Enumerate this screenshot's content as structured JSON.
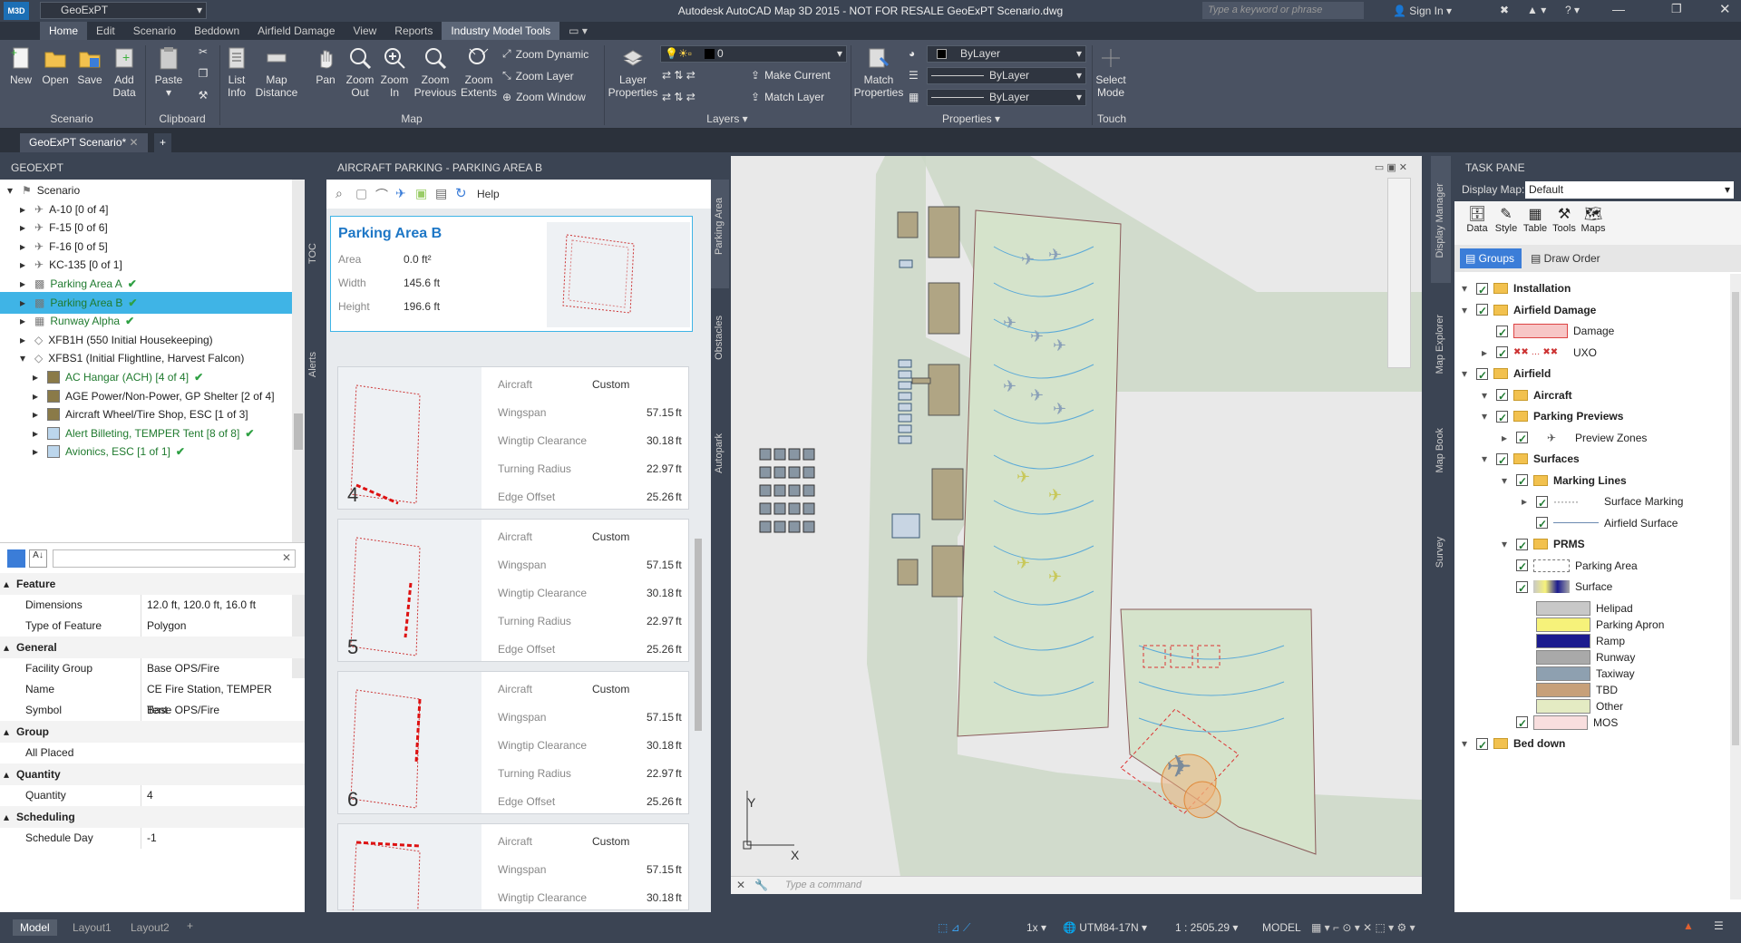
{
  "title_bar": {
    "workspace": "GeoExPT",
    "app_title": "Autodesk AutoCAD Map 3D 2015 - NOT FOR RESALE   GeoExPT Scenario.dwg",
    "search_placeholder": "Type a keyword or phrase",
    "sign_in": "Sign In"
  },
  "menu_tabs": [
    "Home",
    "Edit",
    "Scenario",
    "Beddown",
    "Airfield Damage",
    "View",
    "Reports",
    "Industry Model Tools"
  ],
  "ribbon": {
    "scenario": {
      "buttons": [
        "New",
        "Open",
        "Save",
        "Add Data"
      ],
      "group": "Scenario"
    },
    "clipboard": {
      "buttons": [
        "Paste"
      ],
      "group": "Clipboard"
    },
    "map": {
      "buttons": [
        "List Info",
        "Map Distance",
        "Pan",
        "Zoom Out",
        "Zoom In",
        "Zoom Previous",
        "Zoom Extents"
      ],
      "small": [
        "Zoom Dynamic",
        "Zoom Layer",
        "Zoom Window"
      ],
      "group": "Map"
    },
    "layers": {
      "buttons": [
        "Layer Properties"
      ],
      "layer_combo": "0",
      "small": [
        "Make Current",
        "Match Layer"
      ],
      "group": "Layers"
    },
    "properties": {
      "buttons": [
        "Match Properties"
      ],
      "combos": [
        "ByLayer",
        "ByLayer",
        "ByLayer"
      ],
      "group": "Properties"
    },
    "touch": {
      "buttons": [
        "Select Mode"
      ],
      "group": "Touch"
    }
  },
  "doc_tab": "GeoExPT Scenario*",
  "left_panel": {
    "header": "GEOEXPT",
    "tree": [
      {
        "label": "Scenario",
        "indent": 0
      },
      {
        "label": "A-10 [0 of 4]",
        "indent": 1
      },
      {
        "label": "F-15 [0 of 6]",
        "indent": 1
      },
      {
        "label": "F-16 [0 of 5]",
        "indent": 1
      },
      {
        "label": "KC-135 [0 of 1]",
        "indent": 1
      },
      {
        "label": "Parking Area A",
        "indent": 1,
        "check": true
      },
      {
        "label": "Parking Area B",
        "indent": 1,
        "check": true,
        "selected": true
      },
      {
        "label": "Runway Alpha",
        "indent": 1,
        "check": true
      },
      {
        "label": "XFB1H (550 Initial Housekeeping)",
        "indent": 1
      },
      {
        "label": "XFBS1 (Initial Flightline, Harvest Falcon)",
        "indent": 1
      },
      {
        "label": "AC Hangar (ACH) [4 of 4]",
        "indent": 2,
        "check": true
      },
      {
        "label": "AGE Power/Non-Power, GP Shelter [2 of 4]",
        "indent": 2
      },
      {
        "label": "Aircraft Wheel/Tire Shop, ESC [1 of 3]",
        "indent": 2
      },
      {
        "label": "Alert Billeting, TEMPER Tent [8 of 8]",
        "indent": 2,
        "check": true
      },
      {
        "label": "Avionics, ESC [1 of 1]",
        "indent": 2,
        "check": true
      }
    ],
    "side_tabs": [
      "TOC",
      "Alerts"
    ],
    "properties": {
      "sections": [
        {
          "title": "Feature",
          "rows": [
            {
              "k": "Dimensions",
              "v": "12.0 ft, 120.0 ft, 16.0 ft"
            },
            {
              "k": "Type of Feature",
              "v": "Polygon"
            }
          ]
        },
        {
          "title": "General",
          "rows": [
            {
              "k": "Facility Group",
              "v": "Base OPS/Fire"
            },
            {
              "k": "Name",
              "v": "CE Fire Station, TEMPER Tent"
            },
            {
              "k": "Symbol",
              "v": "Base OPS/Fire"
            }
          ]
        },
        {
          "title": "Group",
          "rows": [
            {
              "k": "All Placed",
              "v": ""
            }
          ]
        },
        {
          "title": "Quantity",
          "rows": [
            {
              "k": "Quantity",
              "v": "4"
            }
          ]
        },
        {
          "title": "Scheduling",
          "rows": [
            {
              "k": "Schedule Day",
              "v": "-1"
            }
          ]
        }
      ]
    }
  },
  "mid_panel": {
    "header": "AIRCRAFT PARKING - PARKING AREA B",
    "help": "Help",
    "summary": {
      "title": "Parking Area B",
      "rows": [
        {
          "k": "Area",
          "v": "0.0 ft²"
        },
        {
          "k": "Width",
          "v": "145.6 ft"
        },
        {
          "k": "Height",
          "v": "196.6 ft"
        }
      ]
    },
    "side_tabs": [
      "Parking Area",
      "Obstacles",
      "Autopark"
    ],
    "cards": [
      {
        "num": "4",
        "rows": [
          {
            "k": "Aircraft",
            "v": "Custom",
            "u": ""
          },
          {
            "k": "Wingspan",
            "v": "57.15",
            "u": "ft"
          },
          {
            "k": "Wingtip Clearance",
            "v": "30.18",
            "u": "ft"
          },
          {
            "k": "Turning Radius",
            "v": "22.97",
            "u": "ft"
          },
          {
            "k": "Edge Offset",
            "v": "25.26",
            "u": "ft"
          }
        ]
      },
      {
        "num": "5",
        "rows": [
          {
            "k": "Aircraft",
            "v": "Custom",
            "u": ""
          },
          {
            "k": "Wingspan",
            "v": "57.15",
            "u": "ft"
          },
          {
            "k": "Wingtip Clearance",
            "v": "30.18",
            "u": "ft"
          },
          {
            "k": "Turning Radius",
            "v": "22.97",
            "u": "ft"
          },
          {
            "k": "Edge Offset",
            "v": "25.26",
            "u": "ft"
          }
        ]
      },
      {
        "num": "6",
        "rows": [
          {
            "k": "Aircraft",
            "v": "Custom",
            "u": ""
          },
          {
            "k": "Wingspan",
            "v": "57.15",
            "u": "ft"
          },
          {
            "k": "Wingtip Clearance",
            "v": "30.18",
            "u": "ft"
          },
          {
            "k": "Turning Radius",
            "v": "22.97",
            "u": "ft"
          },
          {
            "k": "Edge Offset",
            "v": "25.26",
            "u": "ft"
          }
        ]
      },
      {
        "num": "",
        "rows": [
          {
            "k": "Aircraft",
            "v": "Custom",
            "u": ""
          },
          {
            "k": "Wingspan",
            "v": "57.15",
            "u": "ft"
          },
          {
            "k": "Wingtip Clearance",
            "v": "30.18",
            "u": "ft"
          }
        ]
      }
    ]
  },
  "canvas": {
    "command_placeholder": "Type a command",
    "axis_x": "X",
    "axis_y": "Y"
  },
  "task_pane": {
    "header": "TASK PANE",
    "display_map_label": "Display Map:",
    "display_map_value": "Default",
    "tools": [
      "Data",
      "Style",
      "Table",
      "Tools",
      "Maps"
    ],
    "groups_btn": "Groups",
    "draw_order_btn": "Draw Order",
    "side_tabs": [
      "Display Manager",
      "Map Explorer",
      "Map Book",
      "Survey"
    ],
    "items": [
      {
        "label": "Installation",
        "indent": 0,
        "bold": true,
        "folder": true
      },
      {
        "label": "Airfield Damage",
        "indent": 0,
        "bold": true,
        "folder": true
      },
      {
        "label": "Damage",
        "indent": 1,
        "legend": "#f7c6c6"
      },
      {
        "label": "UXO",
        "indent": 1,
        "legend": "uxo"
      },
      {
        "label": "Airfield",
        "indent": 0,
        "bold": true,
        "folder": true
      },
      {
        "label": "Aircraft",
        "indent": 1,
        "bold": true,
        "folder": true
      },
      {
        "label": "Parking Previews",
        "indent": 1,
        "bold": true,
        "folder": true
      },
      {
        "label": "Preview Zones",
        "indent": 2
      },
      {
        "label": "Surfaces",
        "indent": 1,
        "bold": true,
        "folder": true
      },
      {
        "label": "Marking Lines",
        "indent": 2,
        "bold": true,
        "folder": true
      },
      {
        "label": "Surface Marking",
        "indent": 3
      },
      {
        "label": "Airfield Surface",
        "indent": 3
      },
      {
        "label": "PRMS",
        "indent": 2,
        "bold": true,
        "folder": true
      },
      {
        "label": "Parking Area",
        "indent": 2
      },
      {
        "label": "Surface",
        "indent": 2
      },
      {
        "label": "Helipad",
        "indent": 3,
        "swatch": "#c8c8c8"
      },
      {
        "label": "Parking Apron",
        "indent": 3,
        "swatch": "#f6f27a"
      },
      {
        "label": "Ramp",
        "indent": 3,
        "swatch": "#1b1b8f"
      },
      {
        "label": "Runway",
        "indent": 3,
        "swatch": "#a9a9a9"
      },
      {
        "label": "Taxiway",
        "indent": 3,
        "swatch": "#8ea0b0"
      },
      {
        "label": "TBD",
        "indent": 3,
        "swatch": "#c7a079"
      },
      {
        "label": "Other",
        "indent": 3,
        "swatch": "#e4ebc3"
      },
      {
        "label": "MOS",
        "indent": 2,
        "swatch": "#f8dede"
      },
      {
        "label": "Bed down",
        "indent": 0,
        "bold": true,
        "folder": true
      }
    ]
  },
  "status": {
    "layout_tabs": [
      "Model",
      "Layout1",
      "Layout2"
    ],
    "scale_factor": "1x",
    "coord_system": "UTM84-17N",
    "scale": "1 : 2505.29",
    "space": "MODEL"
  }
}
